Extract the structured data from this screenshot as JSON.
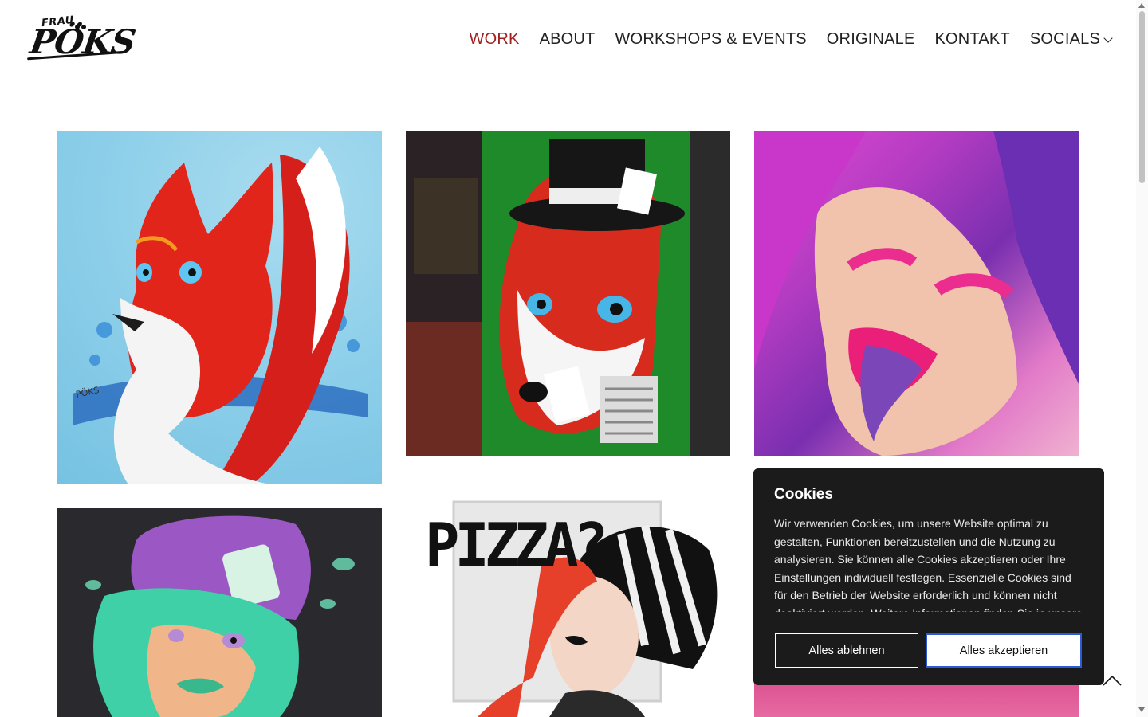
{
  "logo": {
    "small_text": "FRAU",
    "big_text": "PÖKS"
  },
  "nav": {
    "items": [
      {
        "label": "WORK",
        "active": true
      },
      {
        "label": "ABOUT",
        "active": false
      },
      {
        "label": "WORKSHOPS & EVENTS",
        "active": false
      },
      {
        "label": "ORIGINALE",
        "active": false
      },
      {
        "label": "KONTAKT",
        "active": false
      },
      {
        "label": "SOCIALS",
        "active": false,
        "has_dropdown": true
      }
    ]
  },
  "gallery": {
    "fox_signature": "PÖKS",
    "pizza_text": "PIZZA?"
  },
  "cookie": {
    "title": "Cookies",
    "text": "Wir verwenden Cookies, um unsere Website optimal zu gestalten, Funktionen bereitzustellen und die Nutzung zu analysieren. Sie können alle Cookies akzeptieren oder Ihre Einstellungen individuell festlegen. Essenzielle Cookies sind für den Betrieb der Website erforderlich und können nicht deaktiviert werden. Weitere Informationen finden Sie in unsere",
    "reject_label": "Alles ablehnen",
    "accept_label": "Alles akzeptieren"
  },
  "colors": {
    "accent": "#a02020",
    "banner_bg": "#1b1b1b",
    "accept_border": "#2b5bd7"
  },
  "icons": {
    "socials_dropdown": "chevron-down-icon",
    "back_to_top": "chevron-up-icon"
  }
}
